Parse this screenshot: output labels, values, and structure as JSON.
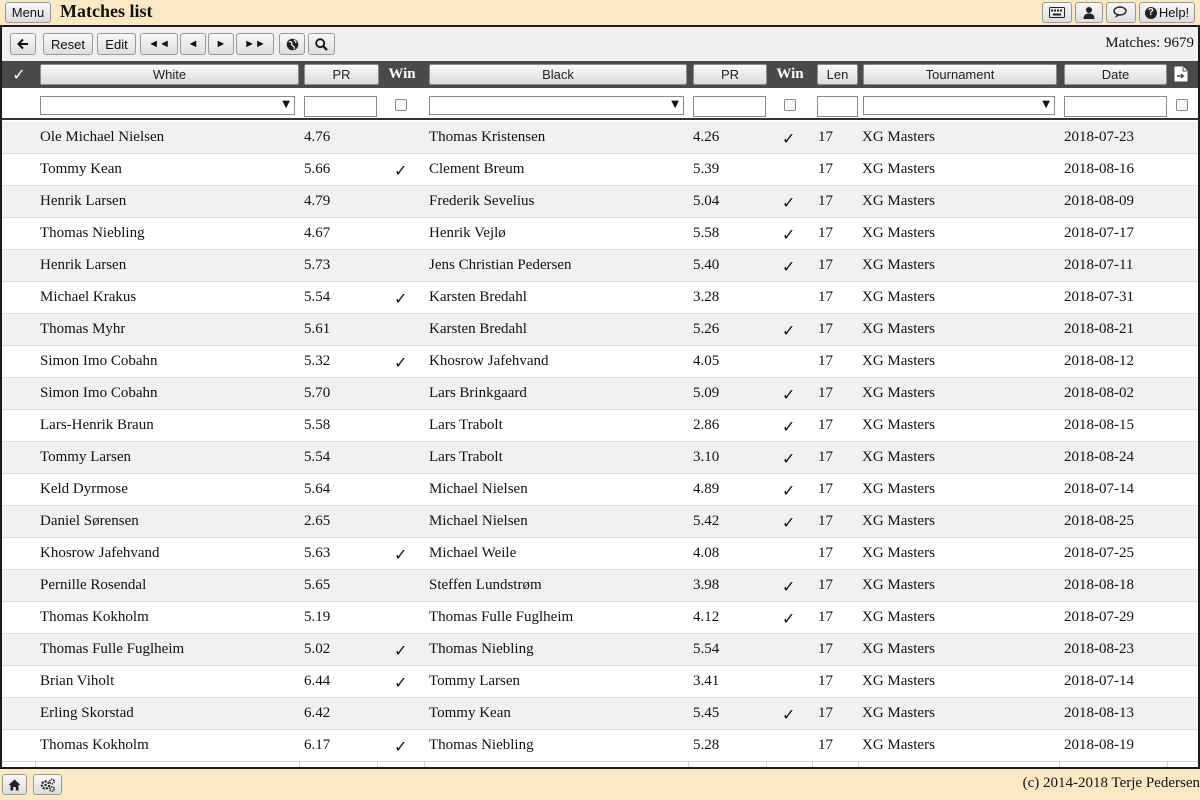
{
  "app": {
    "title": "Matches list",
    "menu_label": "Menu",
    "help_label": "Help!"
  },
  "toolbar": {
    "back_icon": "left-arrow-icon",
    "reset_label": "Reset",
    "edit_label": "Edit",
    "first_label": "◄◄",
    "prev_label": "◄",
    "next_label": "►",
    "last_label": "►►",
    "globe_icon": "globe-icon",
    "search_icon": "search-icon",
    "count_text": "Matches: 9679"
  },
  "columns": {
    "check": "✓",
    "white": "White",
    "pr1": "PR",
    "win1": "Win",
    "black": "Black",
    "pr2": "PR",
    "win2": "Win",
    "len": "Len",
    "tournament": "Tournament",
    "date": "Date",
    "export_icon": "export-icon"
  },
  "filters": {
    "white_value": "",
    "pr1_value": "",
    "black_value": "",
    "pr2_value": "",
    "len_value": "",
    "tournament_value": "",
    "date_value": ""
  },
  "rows": [
    {
      "white": "Ole Michael Nielsen",
      "pr1": "4.76",
      "win1": "",
      "black": "Thomas Kristensen",
      "pr2": "4.26",
      "win2": "✓",
      "len": "17",
      "tournament": "XG Masters",
      "date": "2018-07-23"
    },
    {
      "white": "Tommy Kean",
      "pr1": "5.66",
      "win1": "✓",
      "black": "Clement Breum",
      "pr2": "5.39",
      "win2": "",
      "len": "17",
      "tournament": "XG Masters",
      "date": "2018-08-16"
    },
    {
      "white": "Henrik Larsen",
      "pr1": "4.79",
      "win1": "",
      "black": "Frederik Sevelius",
      "pr2": "5.04",
      "win2": "✓",
      "len": "17",
      "tournament": "XG Masters",
      "date": "2018-08-09"
    },
    {
      "white": "Thomas Niebling",
      "pr1": "4.67",
      "win1": "",
      "black": "Henrik Vejlø",
      "pr2": "5.58",
      "win2": "✓",
      "len": "17",
      "tournament": "XG Masters",
      "date": "2018-07-17"
    },
    {
      "white": "Henrik Larsen",
      "pr1": "5.73",
      "win1": "",
      "black": "Jens Christian Pedersen",
      "pr2": "5.40",
      "win2": "✓",
      "len": "17",
      "tournament": "XG Masters",
      "date": "2018-07-11"
    },
    {
      "white": "Michael Krakus",
      "pr1": "5.54",
      "win1": "✓",
      "black": "Karsten Bredahl",
      "pr2": "3.28",
      "win2": "",
      "len": "17",
      "tournament": "XG Masters",
      "date": "2018-07-31"
    },
    {
      "white": "Thomas Myhr",
      "pr1": "5.61",
      "win1": "",
      "black": "Karsten Bredahl",
      "pr2": "5.26",
      "win2": "✓",
      "len": "17",
      "tournament": "XG Masters",
      "date": "2018-08-21"
    },
    {
      "white": "Simon Imo Cobahn",
      "pr1": "5.32",
      "win1": "✓",
      "black": "Khosrow Jafehvand",
      "pr2": "4.05",
      "win2": "",
      "len": "17",
      "tournament": "XG Masters",
      "date": "2018-08-12"
    },
    {
      "white": "Simon Imo Cobahn",
      "pr1": "5.70",
      "win1": "",
      "black": "Lars Brinkgaard",
      "pr2": "5.09",
      "win2": "✓",
      "len": "17",
      "tournament": "XG Masters",
      "date": "2018-08-02"
    },
    {
      "white": "Lars-Henrik Braun",
      "pr1": "5.58",
      "win1": "",
      "black": "Lars Trabolt",
      "pr2": "2.86",
      "win2": "✓",
      "len": "17",
      "tournament": "XG Masters",
      "date": "2018-08-15"
    },
    {
      "white": "Tommy Larsen",
      "pr1": "5.54",
      "win1": "",
      "black": "Lars Trabolt",
      "pr2": "3.10",
      "win2": "✓",
      "len": "17",
      "tournament": "XG Masters",
      "date": "2018-08-24"
    },
    {
      "white": "Keld Dyrmose",
      "pr1": "5.64",
      "win1": "",
      "black": "Michael Nielsen",
      "pr2": "4.89",
      "win2": "✓",
      "len": "17",
      "tournament": "XG Masters",
      "date": "2018-07-14"
    },
    {
      "white": "Daniel Sørensen",
      "pr1": "2.65",
      "win1": "",
      "black": "Michael Nielsen",
      "pr2": "5.42",
      "win2": "✓",
      "len": "17",
      "tournament": "XG Masters",
      "date": "2018-08-25"
    },
    {
      "white": "Khosrow Jafehvand",
      "pr1": "5.63",
      "win1": "✓",
      "black": "Michael Weile",
      "pr2": "4.08",
      "win2": "",
      "len": "17",
      "tournament": "XG Masters",
      "date": "2018-07-25"
    },
    {
      "white": "Pernille Rosendal",
      "pr1": "5.65",
      "win1": "",
      "black": "Steffen Lundstrøm",
      "pr2": "3.98",
      "win2": "✓",
      "len": "17",
      "tournament": "XG Masters",
      "date": "2018-08-18"
    },
    {
      "white": "Thomas Kokholm",
      "pr1": "5.19",
      "win1": "",
      "black": "Thomas Fulle Fuglheim",
      "pr2": "4.12",
      "win2": "✓",
      "len": "17",
      "tournament": "XG Masters",
      "date": "2018-07-29"
    },
    {
      "white": "Thomas Fulle Fuglheim",
      "pr1": "5.02",
      "win1": "✓",
      "black": "Thomas Niebling",
      "pr2": "5.54",
      "win2": "",
      "len": "17",
      "tournament": "XG Masters",
      "date": "2018-08-23"
    },
    {
      "white": "Brian Viholt",
      "pr1": "6.44",
      "win1": "✓",
      "black": "Tommy Larsen",
      "pr2": "3.41",
      "win2": "",
      "len": "17",
      "tournament": "XG Masters",
      "date": "2018-07-14"
    },
    {
      "white": "Erling Skorstad",
      "pr1": "6.42",
      "win1": "",
      "black": "Tommy Kean",
      "pr2": "5.45",
      "win2": "✓",
      "len": "17",
      "tournament": "XG Masters",
      "date": "2018-08-13"
    },
    {
      "white": "Thomas Kokholm",
      "pr1": "6.17",
      "win1": "✓",
      "black": "Thomas Niebling",
      "pr2": "5.28",
      "win2": "",
      "len": "17",
      "tournament": "XG Masters",
      "date": "2018-08-19"
    }
  ],
  "footer": {
    "copyright": "(c) 2014-2018 Terje Pedersen",
    "home_icon": "home-icon",
    "settings_icon": "gears-icon"
  }
}
